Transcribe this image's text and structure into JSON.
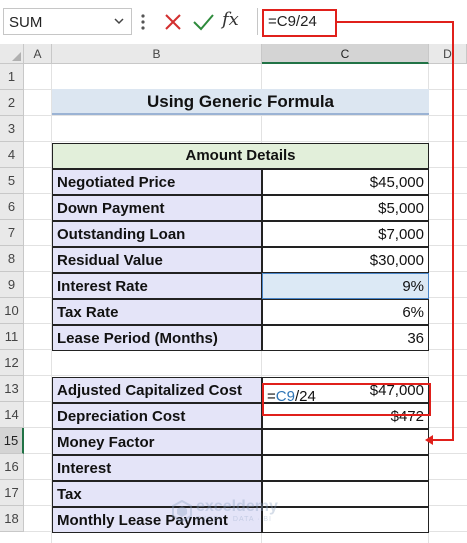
{
  "formula_bar": {
    "name_box": "SUM",
    "formula": "=C9/24",
    "icons": [
      "chevron-down-icon",
      "more-dots-icon",
      "cancel-icon",
      "enter-checkmark-icon",
      "insert-function-icon"
    ]
  },
  "columns": [
    "A",
    "B",
    "C",
    "D"
  ],
  "selected_column": "C",
  "rows": [
    "1",
    "2",
    "3",
    "4",
    "5",
    "6",
    "7",
    "8",
    "9",
    "10",
    "11",
    "12",
    "13",
    "14",
    "15",
    "16",
    "17",
    "18"
  ],
  "selected_row": "15",
  "title": "Using Generic Formula",
  "table1": {
    "header": "Amount Details",
    "rows": [
      {
        "label": "Negotiated Price",
        "value": "$45,000"
      },
      {
        "label": "Down Payment",
        "value": "$5,000"
      },
      {
        "label": "Outstanding Loan",
        "value": "$7,000"
      },
      {
        "label": "Residual Value",
        "value": "$30,000"
      },
      {
        "label": "Interest Rate",
        "value": "9%"
      },
      {
        "label": "Tax Rate",
        "value": "6%"
      },
      {
        "label": "Lease Period (Months)",
        "value": "36"
      }
    ]
  },
  "table2": {
    "rows": [
      {
        "label": "Adjusted Capitalized Cost",
        "value": "$47,000"
      },
      {
        "label": "Depreciation Cost",
        "value": "$472"
      },
      {
        "label": "Money Factor",
        "value": ""
      },
      {
        "label": "Interest",
        "value": ""
      },
      {
        "label": "Tax",
        "value": ""
      },
      {
        "label": "Monthly Lease Payment",
        "value": ""
      }
    ]
  },
  "edit_cell": {
    "prefix": "=",
    "ref": "C9",
    "suffix": "/24"
  },
  "watermark": {
    "name": "exceldemy",
    "tagline": "EXCEL · DATA · BI"
  },
  "colors": {
    "accent_red": "#e0201b",
    "header_green": "#e2efda",
    "label_purple": "#e4e4f8",
    "title_blue": "#dce6f1",
    "ref_blue": "#2e75b6"
  }
}
